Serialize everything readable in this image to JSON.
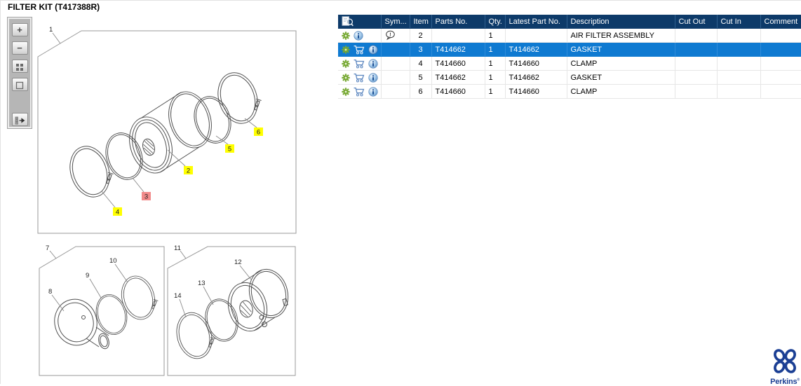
{
  "page": {
    "title": "FILTER KIT (T417388R)"
  },
  "viewer": {
    "toolbar": [
      {
        "name": "zoom-in-button",
        "glyph": "+"
      },
      {
        "name": "zoom-out-button",
        "glyph": "−"
      },
      {
        "name": "tile-view-button",
        "glyph": "grid-icon"
      },
      {
        "name": "fit-view-button",
        "glyph": "square-icon"
      },
      {
        "name": "toggle-panel-button",
        "glyph": "panel-arrow-icon"
      }
    ],
    "figures": [
      {
        "label": "1",
        "callouts": [
          {
            "n": "2",
            "highlight": "#ffff00"
          },
          {
            "n": "3",
            "highlight": "#f28c8c"
          },
          {
            "n": "4",
            "highlight": "#ffff00"
          },
          {
            "n": "5",
            "highlight": "#ffff00"
          },
          {
            "n": "6",
            "highlight": "#ffff00"
          }
        ]
      },
      {
        "label": "7",
        "callouts": [
          {
            "n": "8"
          },
          {
            "n": "9"
          },
          {
            "n": "10"
          }
        ]
      },
      {
        "label": "11",
        "callouts": [
          {
            "n": "12"
          },
          {
            "n": "13"
          },
          {
            "n": "14"
          }
        ]
      }
    ]
  },
  "table": {
    "header_icon": "document-search-icon",
    "columns": [
      "",
      "Sym...",
      "Item",
      "Parts No.",
      "Qty.",
      "Latest Part No.",
      "Description",
      "Cut Out",
      "Cut In",
      "Comment"
    ],
    "rows": [
      {
        "selected": false,
        "symbol": "note-balloon-icon",
        "actions": [
          "gear-icon",
          "info-icon"
        ],
        "item": "2",
        "parts_no": "",
        "qty": "1",
        "latest_part_no": "",
        "description": "AIR FILTER ASSEMBLY",
        "cut_out": "",
        "cut_in": "",
        "comment": ""
      },
      {
        "selected": true,
        "symbol": "",
        "actions": [
          "gear-icon",
          "cart-icon",
          "info-icon"
        ],
        "item": "3",
        "parts_no": "T414662",
        "qty": "1",
        "latest_part_no": "T414662",
        "description": "GASKET",
        "cut_out": "",
        "cut_in": "",
        "comment": ""
      },
      {
        "selected": false,
        "symbol": "",
        "actions": [
          "gear-icon",
          "cart-icon",
          "info-icon"
        ],
        "item": "4",
        "parts_no": "T414660",
        "qty": "1",
        "latest_part_no": "T414660",
        "description": "CLAMP",
        "cut_out": "",
        "cut_in": "",
        "comment": ""
      },
      {
        "selected": false,
        "symbol": "",
        "actions": [
          "gear-icon",
          "cart-icon",
          "info-icon"
        ],
        "item": "5",
        "parts_no": "T414662",
        "qty": "1",
        "latest_part_no": "T414662",
        "description": "GASKET",
        "cut_out": "",
        "cut_in": "",
        "comment": ""
      },
      {
        "selected": false,
        "symbol": "",
        "actions": [
          "gear-icon",
          "cart-icon",
          "info-icon"
        ],
        "item": "6",
        "parts_no": "T414660",
        "qty": "1",
        "latest_part_no": "T414660",
        "description": "CLAMP",
        "cut_out": "",
        "cut_in": "",
        "comment": ""
      }
    ]
  },
  "brand": {
    "name": "Perkins",
    "mark": "®"
  },
  "colors": {
    "table_header_bg": "#0d3a69",
    "selected_row_bg": "#0f7ad1",
    "callout_yellow": "#ffff00",
    "callout_selected_red": "#f28c8c",
    "gear_green": "#76a832",
    "cart_blue": "#5d87c0",
    "brand_blue": "#1b3f94"
  }
}
